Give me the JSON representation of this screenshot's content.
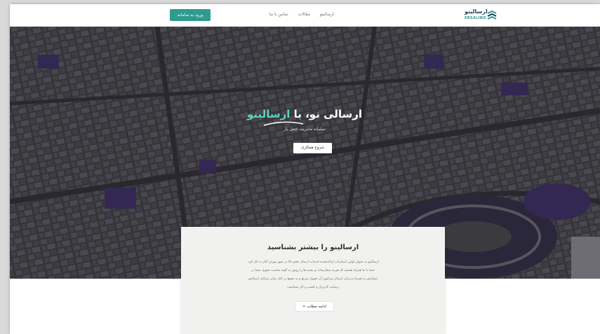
{
  "colors": {
    "accent": "#2f9b8e",
    "accent_light": "#5fd2c1",
    "hero_overlay": "#3b3a40",
    "water": "#3a2c63",
    "card_bg": "#f1f1ef"
  },
  "header": {
    "signin_label": "ورود به سامانه",
    "nav": [
      "ارسالینو",
      "مقالات",
      "تماس با ما"
    ],
    "logo_name": "ارسالینو",
    "logo_en": "ERSALINO",
    "logo_icon": "stacked-chevrons-icon"
  },
  "hero": {
    "title_prefix": "ارسالی نو، با",
    "title_brand": "ارسالینو",
    "subtitle": "سامانه مدیریت حمل بار",
    "cta_label": "شروع همکاری",
    "background": "aerial-city-map"
  },
  "about": {
    "title": "ارسالینو را بیشتر بشناسید",
    "lines": [
      "ارسالینو به عنوان اولین استارتاپ ارائه‌دهنده خدمات ارسال حجم بالا در شهر تهران آغاز به کار کرد.",
      "حتما با ما همراه هستید که هزینه سفارشات و بسته ها را روش به گونه مناسب تحویل شما در",
      "سفارش به همراه و زمان ارسال پیرامون آن تحویل سریع و به موقع در کنار سایر مزایای ارسالینو",
      "رضایت کاربران و کسب و کار شماست"
    ],
    "cta_label": "ادامه مطلب >"
  }
}
